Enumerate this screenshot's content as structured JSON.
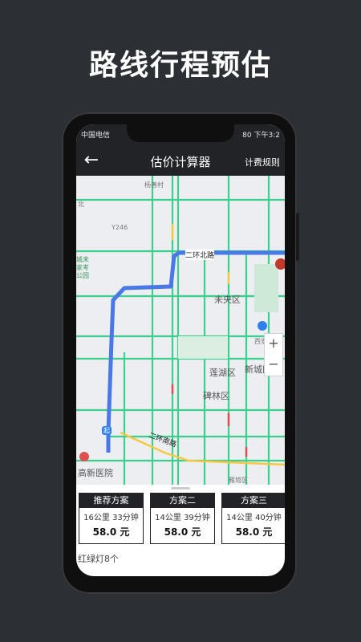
{
  "headline": "路线行程预估",
  "status": {
    "carrier": "中国电信",
    "signal": "···ℙℙ",
    "battery": "80",
    "time": "下午3:2"
  },
  "header": {
    "back_icon": "←",
    "title": "估价计算器",
    "rules_label": "计费规则"
  },
  "map_labels": {
    "yangqiao": "杨善村",
    "north": "北",
    "y246": "Y246",
    "park": "城未\n家考\n公园",
    "ring2": "二环北路",
    "weiyang": "未央区",
    "xian_north": "西安",
    "lianhu": "莲湖区",
    "xincheng": "新城区",
    "beilin": "碑林区",
    "ring2s": "二环南路",
    "hospital": "高新医院",
    "yanta": "雁塔区",
    "start": "起",
    "zoom_in": "+",
    "zoom_out": "−"
  },
  "plans": [
    {
      "name": "推荐方案",
      "desc": "16公里 33分钟",
      "price": "58.0 元"
    },
    {
      "name": "方案二",
      "desc": "14公里 39分钟",
      "price": "58.0 元"
    },
    {
      "name": "方案三",
      "desc": "14公里 40分钟",
      "price": "58.0 元"
    }
  ],
  "traffic_lights": "红绿灯8个",
  "colors": {
    "route": "#4a78e6",
    "road_green": "#3ecf8e",
    "road_yellow": "#f5c842",
    "road_red": "#e04f4f",
    "bar": "#222326"
  }
}
